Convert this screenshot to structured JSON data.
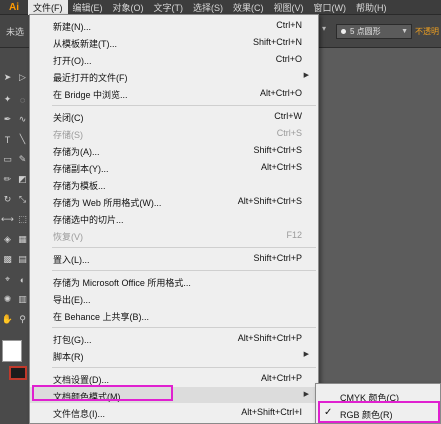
{
  "app": {
    "logo": "Ai"
  },
  "menubar": {
    "items": [
      "文件(F)",
      "编辑(E)",
      "对象(O)",
      "文字(T)",
      "选择(S)",
      "效果(C)",
      "视图(V)",
      "窗口(W)",
      "帮助(H)"
    ],
    "active": "文件(F)"
  },
  "controlbar": {
    "doc_label": "未选",
    "brush_select": "5 点圆形",
    "style_label": "不透明"
  },
  "file_menu": {
    "items": [
      {
        "label": "新建(N)...",
        "shortcut": "Ctrl+N",
        "enabled": true,
        "submenu": false
      },
      {
        "label": "从模板新建(T)...",
        "shortcut": "Shift+Ctrl+N",
        "enabled": true,
        "submenu": false
      },
      {
        "label": "打开(O)...",
        "shortcut": "Ctrl+O",
        "enabled": true,
        "submenu": false
      },
      {
        "label": "最近打开的文件(F)",
        "shortcut": "",
        "enabled": true,
        "submenu": true
      },
      {
        "label": "在 Bridge 中浏览...",
        "shortcut": "Alt+Ctrl+O",
        "enabled": true,
        "submenu": false
      },
      {
        "label": "关闭(C)",
        "shortcut": "Ctrl+W",
        "enabled": true,
        "submenu": false
      },
      {
        "label": "存储(S)",
        "shortcut": "Ctrl+S",
        "enabled": false,
        "submenu": false
      },
      {
        "label": "存储为(A)...",
        "shortcut": "Shift+Ctrl+S",
        "enabled": true,
        "submenu": false
      },
      {
        "label": "存储副本(Y)...",
        "shortcut": "Alt+Ctrl+S",
        "enabled": true,
        "submenu": false
      },
      {
        "label": "存储为模板...",
        "shortcut": "",
        "enabled": true,
        "submenu": false
      },
      {
        "label": "存储为 Web 所用格式(W)...",
        "shortcut": "Alt+Shift+Ctrl+S",
        "enabled": true,
        "submenu": false
      },
      {
        "label": "存储选中的切片...",
        "shortcut": "",
        "enabled": true,
        "submenu": false
      },
      {
        "label": "恢复(V)",
        "shortcut": "F12",
        "enabled": false,
        "submenu": false
      },
      {
        "label": "置入(L)...",
        "shortcut": "Shift+Ctrl+P",
        "enabled": true,
        "submenu": false
      },
      {
        "label": "存储为 Microsoft Office 所用格式...",
        "shortcut": "",
        "enabled": true,
        "submenu": false
      },
      {
        "label": "导出(E)...",
        "shortcut": "",
        "enabled": true,
        "submenu": false
      },
      {
        "label": "在 Behance 上共享(B)...",
        "shortcut": "",
        "enabled": true,
        "submenu": false
      },
      {
        "label": "打包(G)...",
        "shortcut": "Alt+Shift+Ctrl+P",
        "enabled": true,
        "submenu": false
      },
      {
        "label": "脚本(R)",
        "shortcut": "",
        "enabled": true,
        "submenu": true
      },
      {
        "label": "文档设置(D)...",
        "shortcut": "Alt+Ctrl+P",
        "enabled": true,
        "submenu": false
      },
      {
        "label": "文档颜色模式(M)",
        "shortcut": "",
        "enabled": true,
        "submenu": true
      },
      {
        "label": "文件信息(I)...",
        "shortcut": "Alt+Shift+Ctrl+I",
        "enabled": true,
        "submenu": false
      }
    ]
  },
  "color_mode_submenu": {
    "items": [
      {
        "label": "CMYK 颜色(C)",
        "checked": false
      },
      {
        "label": "RGB 颜色(R)",
        "checked": true
      }
    ]
  },
  "icons": {
    "selection": "arrow-icon",
    "check": "check-icon"
  },
  "colors": {
    "highlight": "#e020d0",
    "logo": "#ff9a00"
  }
}
